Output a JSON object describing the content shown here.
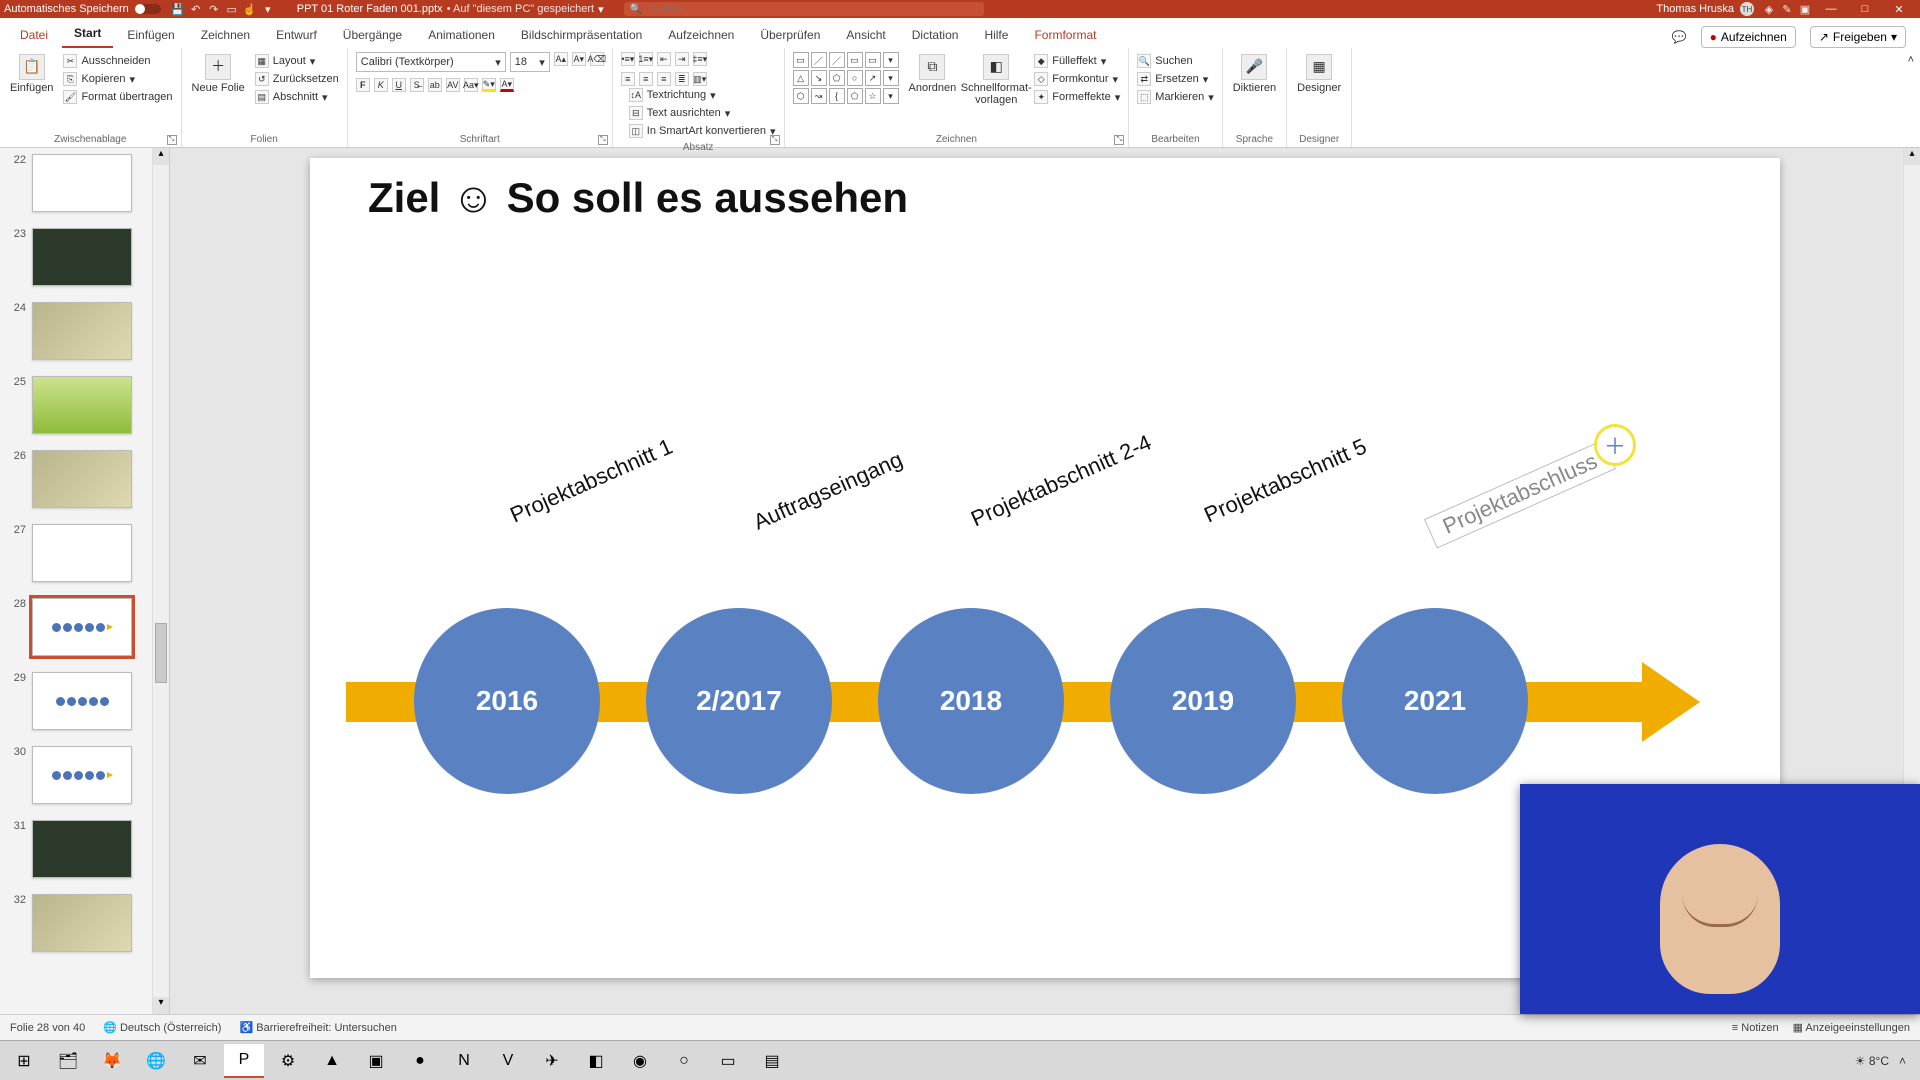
{
  "titlebar": {
    "autosave_label": "Automatisches Speichern",
    "filename": "PPT 01 Roter Faden 001.pptx",
    "saved_hint": "• Auf \"diesem PC\" gespeichert",
    "search_placeholder": "Suchen",
    "user_name": "Thomas Hruska",
    "user_initials": "TH"
  },
  "tabs": {
    "file": "Datei",
    "home": "Start",
    "insert": "Einfügen",
    "draw": "Zeichnen",
    "design": "Entwurf",
    "transitions": "Übergänge",
    "animations": "Animationen",
    "slideshow": "Bildschirmpräsentation",
    "record": "Aufzeichnen",
    "review": "Überprüfen",
    "view": "Ansicht",
    "dictation": "Dictation",
    "help": "Hilfe",
    "shapeformat": "Formformat",
    "rec_button": "Aufzeichnen",
    "share_button": "Freigeben"
  },
  "ribbon": {
    "paste": "Einfügen",
    "cut": "Ausschneiden",
    "copy": "Kopieren",
    "format_painter": "Format übertragen",
    "clipboard_group": "Zwischenablage",
    "new_slide": "Neue Folie",
    "layout": "Layout",
    "reset": "Zurücksetzen",
    "section": "Abschnitt",
    "slides_group": "Folien",
    "font_name": "Calibri (Textkörper)",
    "font_size": "18",
    "font_group": "Schriftart",
    "paragraph_group": "Absatz",
    "text_direction": "Textrichtung",
    "text_align": "Text ausrichten",
    "smartart": "In SmartArt konvertieren",
    "arrange": "Anordnen",
    "quick_styles": "Schnellformat-vorlagen",
    "shape_fill": "Fülleffekt",
    "shape_outline": "Formkontur",
    "shape_effects": "Formeffekte",
    "drawing_group": "Zeichnen",
    "find": "Suchen",
    "replace": "Ersetzen",
    "select": "Markieren",
    "editing_group": "Bearbeiten",
    "dictate": "Diktieren",
    "voice_group": "Sprache",
    "designer": "Designer",
    "designer_group": "Designer"
  },
  "thumbs": {
    "items": [
      {
        "n": "22"
      },
      {
        "n": "23"
      },
      {
        "n": "24"
      },
      {
        "n": "25"
      },
      {
        "n": "26"
      },
      {
        "n": "27"
      },
      {
        "n": "28"
      },
      {
        "n": "29"
      },
      {
        "n": "30"
      },
      {
        "n": "31"
      },
      {
        "n": "32"
      }
    ]
  },
  "slide": {
    "title": "Ziel ☺  So soll es aussehen",
    "labels": [
      "Projektabschnitt 1",
      "Auftragseingang",
      "Projektabschnitt 2-4",
      "Projektabschnitt 5",
      "Projektabschluss"
    ],
    "years": [
      "2016",
      "2/2017",
      "2018",
      "2019",
      "2021"
    ]
  },
  "status": {
    "slide_counter": "Folie 28 von 40",
    "language": "Deutsch (Österreich)",
    "accessibility": "Barrierefreiheit: Untersuchen",
    "notes": "Notizen",
    "display_settings": "Anzeigeeinstellungen"
  },
  "taskbar": {
    "weather": "8°C"
  }
}
